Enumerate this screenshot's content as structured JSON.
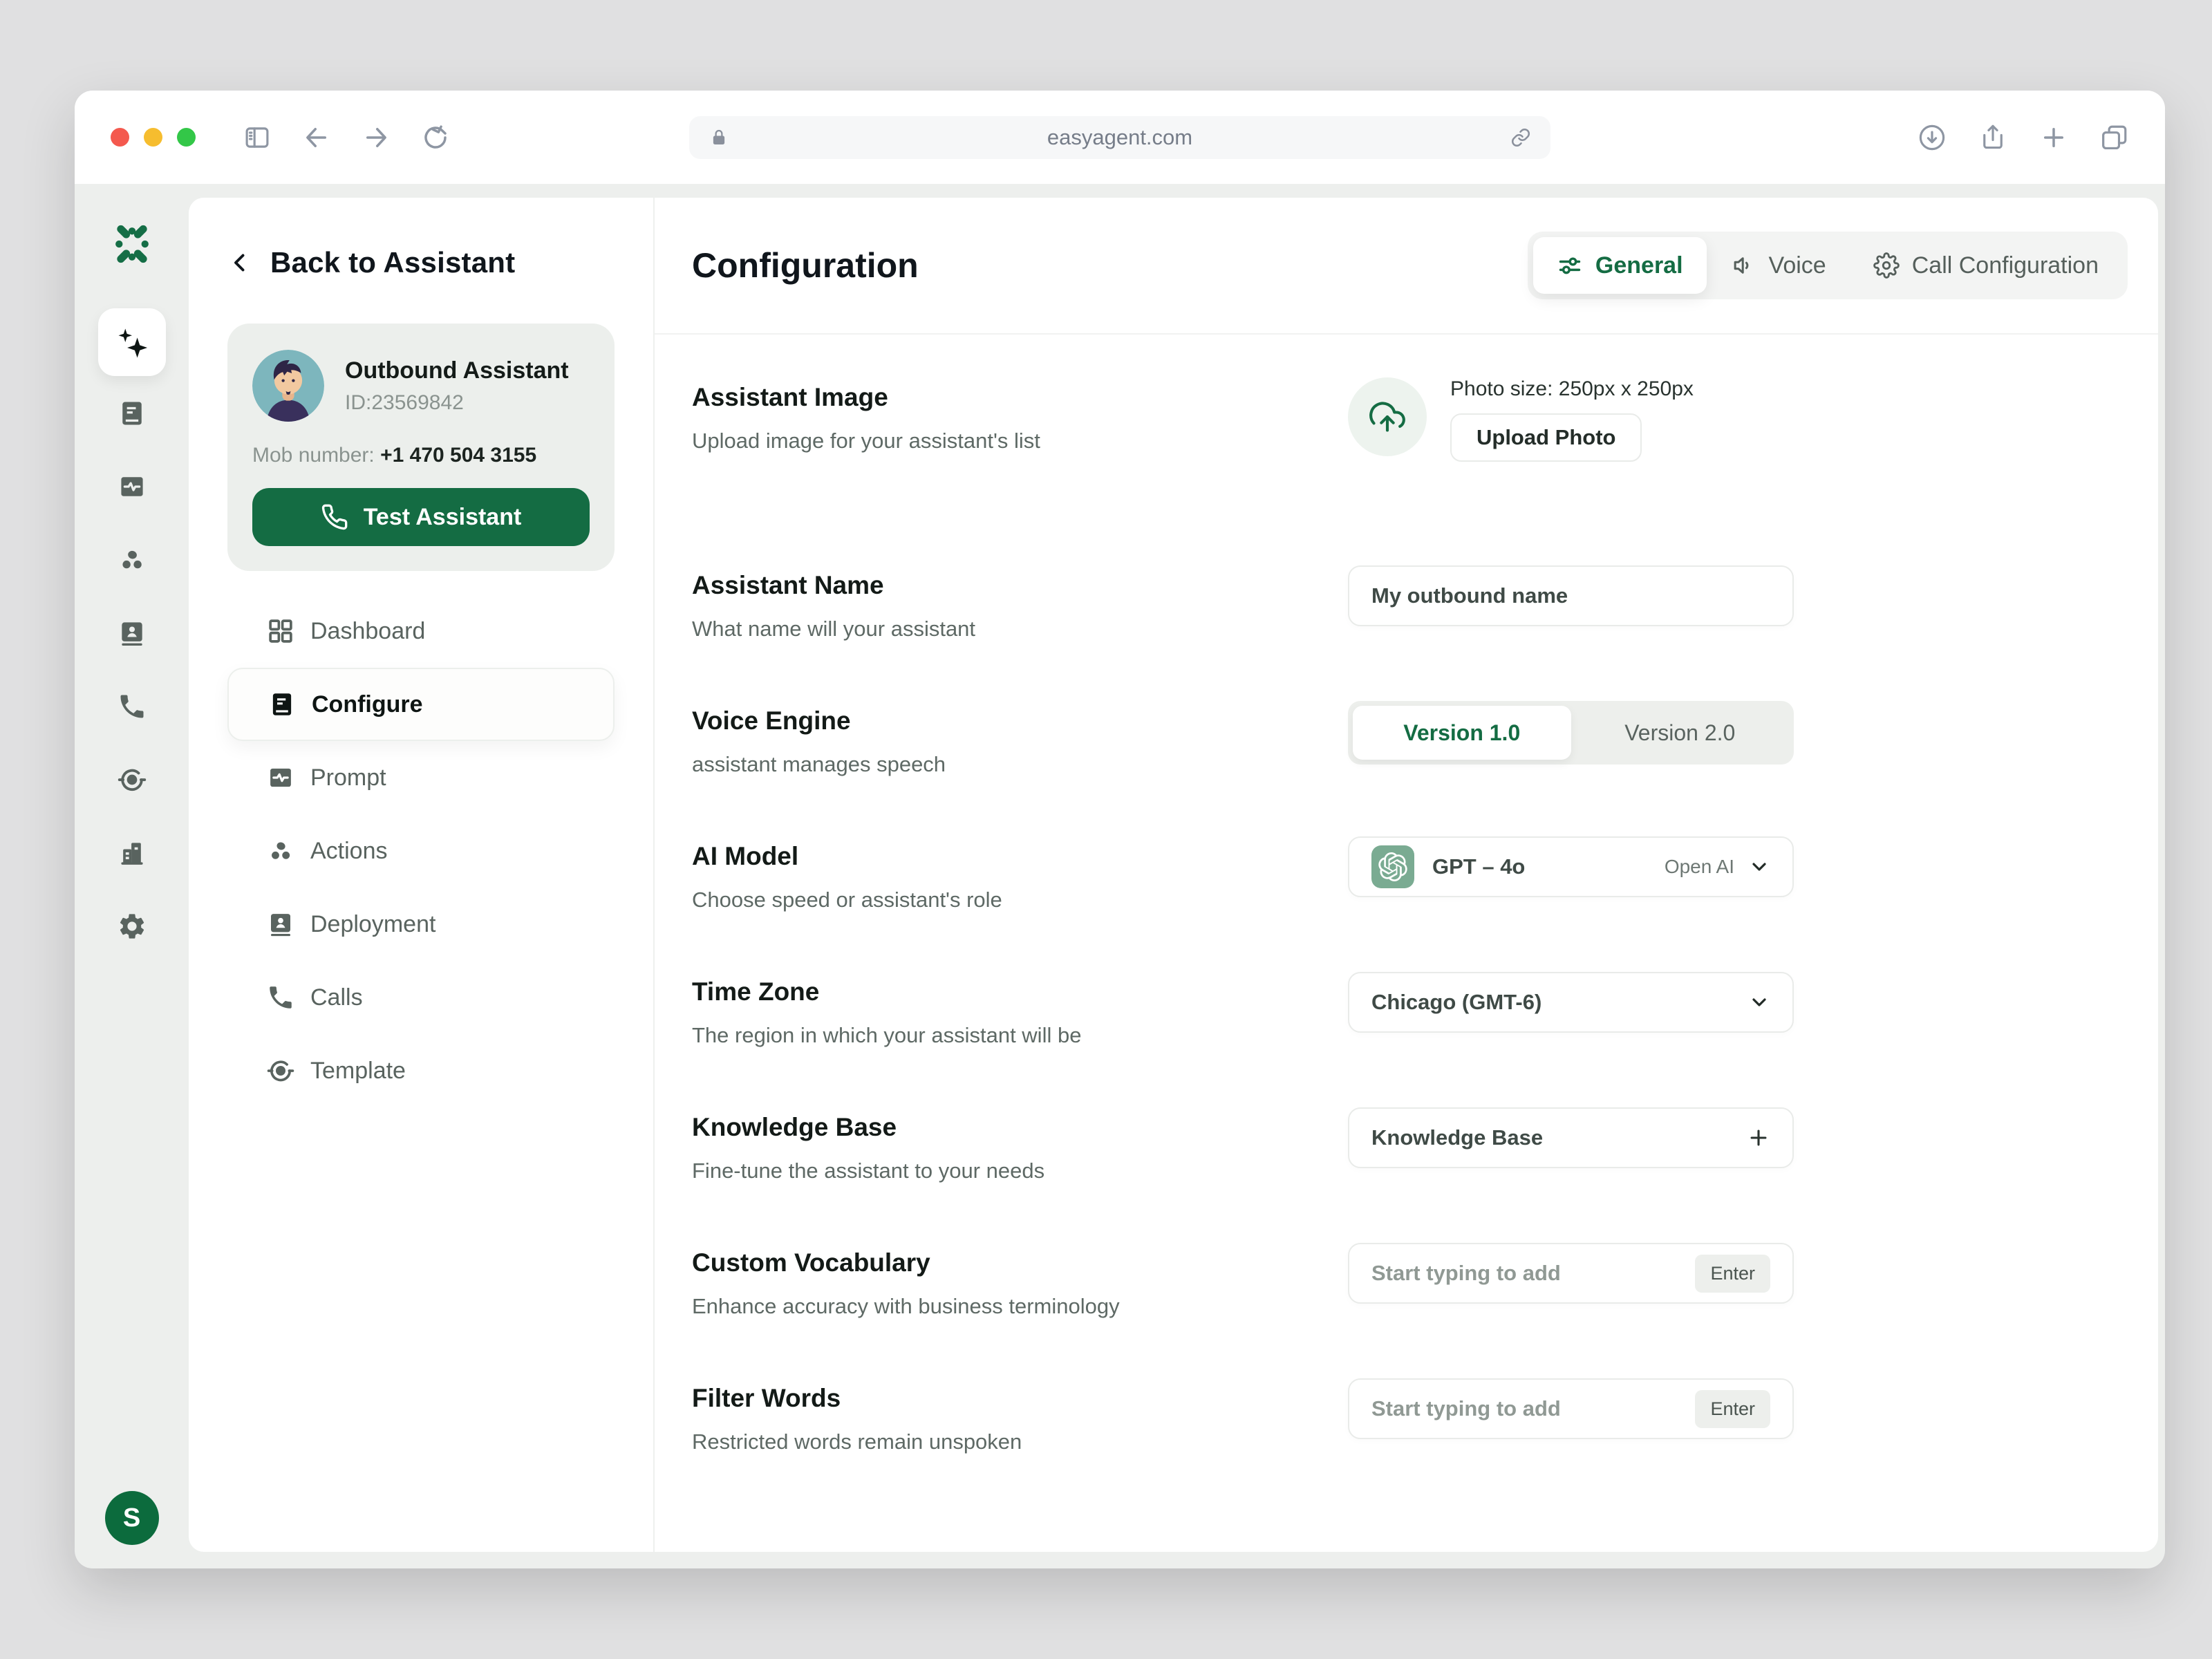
{
  "theme": {
    "accent_green": "#146C43",
    "openai_tile": "#7aab92",
    "rail_bg": "#edefed"
  },
  "browser": {
    "url": "easyagent.com"
  },
  "rail": {
    "user_initial": "S"
  },
  "sidebar": {
    "back_label": "Back to Assistant",
    "assistant": {
      "name": "Outbound Assistant",
      "id": "ID:23569842",
      "mob_label": "Mob number:",
      "mob_number": "+1 470 504 3155",
      "test_button": "Test Assistant"
    },
    "nav": [
      {
        "label": "Dashboard"
      },
      {
        "label": "Configure"
      },
      {
        "label": "Prompt"
      },
      {
        "label": "Actions"
      },
      {
        "label": "Deployment"
      },
      {
        "label": "Calls"
      },
      {
        "label": "Template"
      }
    ]
  },
  "header": {
    "title": "Configuration",
    "tabs": [
      {
        "label": "General",
        "active": true
      },
      {
        "label": "Voice",
        "active": false
      },
      {
        "label": "Call Configuration",
        "active": false
      }
    ]
  },
  "form": {
    "assistant_image": {
      "label": "Assistant Image",
      "hint": "Upload image for your assistant's list",
      "photo_size": "Photo size: 250px x 250px",
      "upload_button": "Upload Photo"
    },
    "assistant_name": {
      "label": "Assistant Name",
      "hint": "What name will your assistant",
      "value": "My outbound name"
    },
    "voice_engine": {
      "label": "Voice Engine",
      "hint": "assistant manages speech",
      "options": [
        "Version 1.0",
        "Version 2.0"
      ],
      "selected": "Version 1.0"
    },
    "ai_model": {
      "label": "AI Model",
      "hint": "Choose speed or assistant's role",
      "value": "GPT – 4o",
      "provider": "Open AI"
    },
    "time_zone": {
      "label": "Time Zone",
      "hint": "The region in which your assistant will be",
      "value": "Chicago (GMT-6)"
    },
    "knowledge_base": {
      "label": "Knowledge Base",
      "hint": "Fine-tune the assistant to your needs",
      "value": "Knowledge Base"
    },
    "custom_vocabulary": {
      "label": "Custom Vocabulary",
      "hint": "Enhance accuracy with business terminology",
      "placeholder": "Start typing to add",
      "key_hint": "Enter"
    },
    "filter_words": {
      "label": "Filter Words",
      "hint": "Restricted words remain unspoken",
      "placeholder": "Start typing to add",
      "key_hint": "Enter"
    }
  }
}
